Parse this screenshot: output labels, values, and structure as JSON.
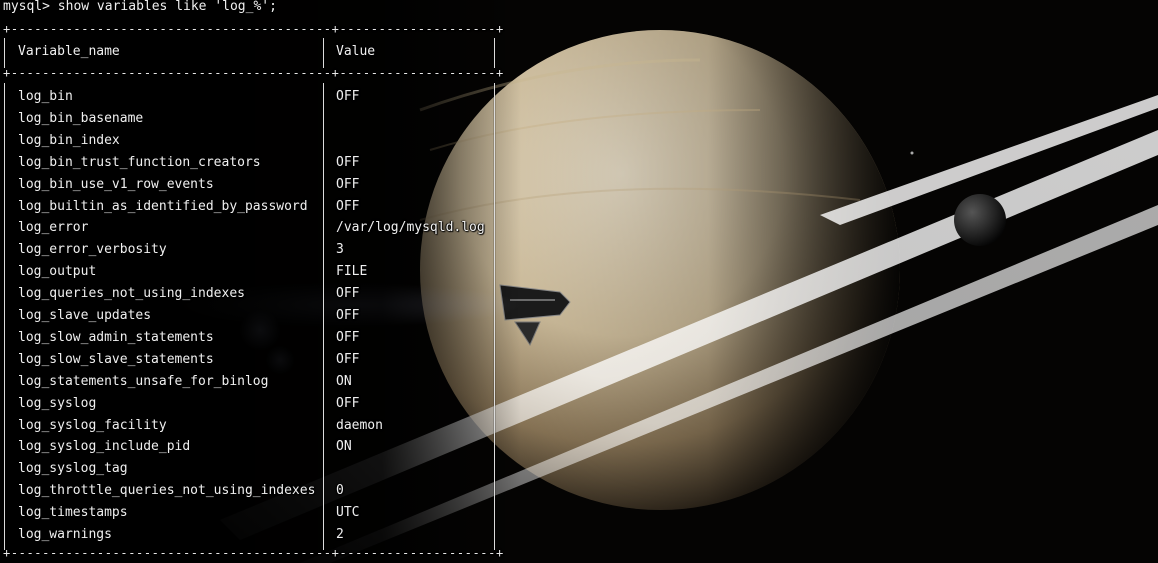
{
  "terminal": {
    "prompt": "mysql>",
    "command": "show variables like 'log_%';",
    "separator": "+-----------------------------------------+--------------------+",
    "headers": {
      "name": "Variable_name",
      "value": "Value"
    },
    "rows": [
      {
        "name": "log_bin",
        "value": "OFF"
      },
      {
        "name": "log_bin_basename",
        "value": ""
      },
      {
        "name": "log_bin_index",
        "value": ""
      },
      {
        "name": "log_bin_trust_function_creators",
        "value": "OFF"
      },
      {
        "name": "log_bin_use_v1_row_events",
        "value": "OFF"
      },
      {
        "name": "log_builtin_as_identified_by_password",
        "value": "OFF"
      },
      {
        "name": "log_error",
        "value": "/var/log/mysqld.log"
      },
      {
        "name": "log_error_verbosity",
        "value": "3"
      },
      {
        "name": "log_output",
        "value": "FILE"
      },
      {
        "name": "log_queries_not_using_indexes",
        "value": "OFF"
      },
      {
        "name": "log_slave_updates",
        "value": "OFF"
      },
      {
        "name": "log_slow_admin_statements",
        "value": "OFF"
      },
      {
        "name": "log_slow_slave_statements",
        "value": "OFF"
      },
      {
        "name": "log_statements_unsafe_for_binlog",
        "value": "ON"
      },
      {
        "name": "log_syslog",
        "value": "OFF"
      },
      {
        "name": "log_syslog_facility",
        "value": "daemon"
      },
      {
        "name": "log_syslog_include_pid",
        "value": "ON"
      },
      {
        "name": "log_syslog_tag",
        "value": ""
      },
      {
        "name": "log_throttle_queries_not_using_indexes",
        "value": "0"
      },
      {
        "name": "log_timestamps",
        "value": "UTC"
      },
      {
        "name": "log_warnings",
        "value": "2"
      }
    ]
  },
  "colors": {
    "text": "#f0f0f0",
    "background": "#000000",
    "planet": "#e9dcc0"
  },
  "wallpaper": {
    "subject": "saturn-with-spaceship"
  }
}
